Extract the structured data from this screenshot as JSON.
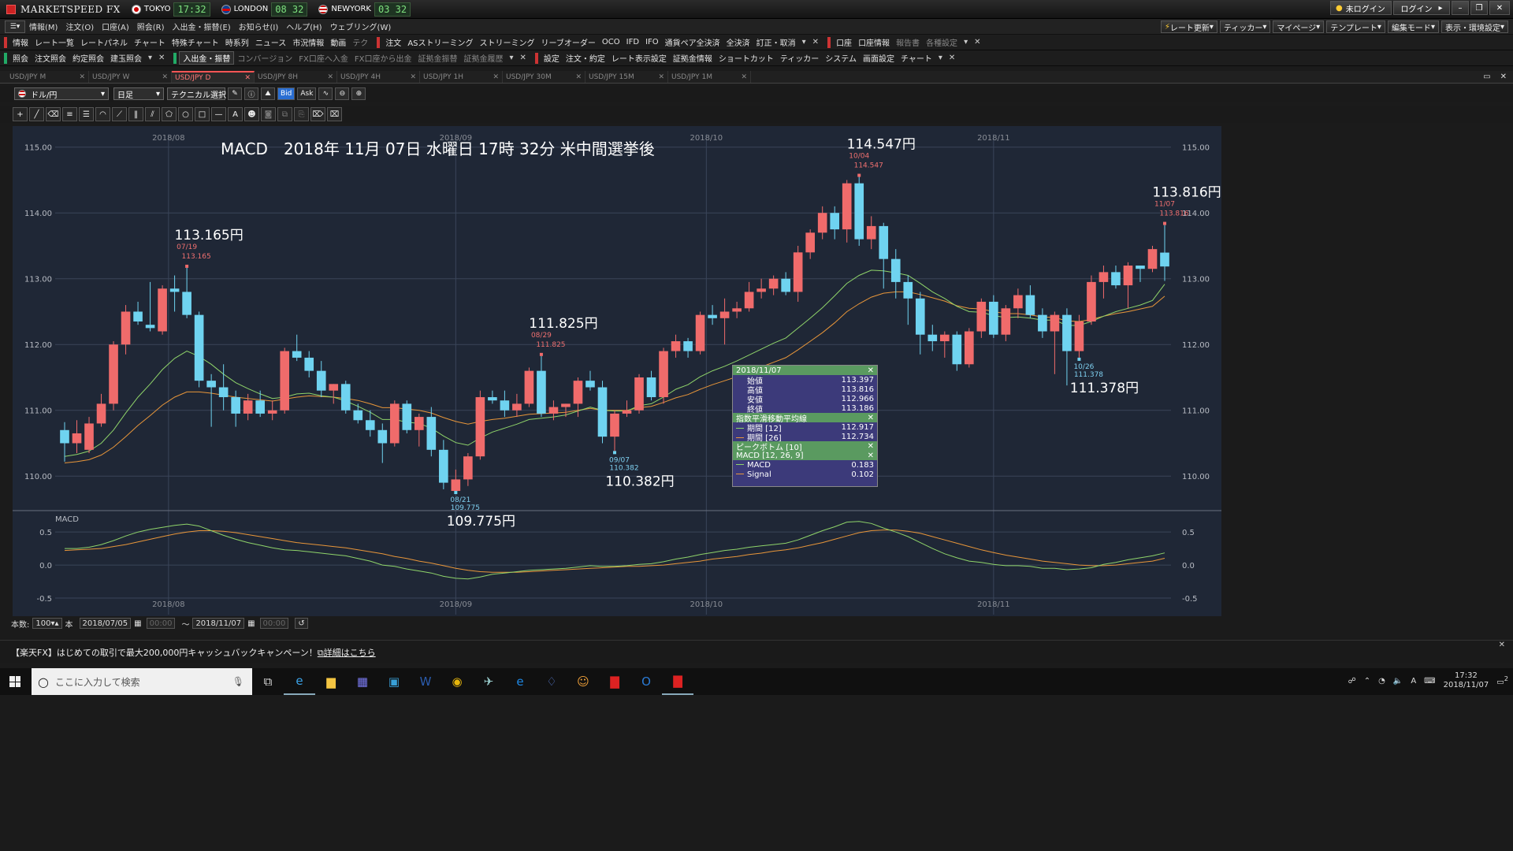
{
  "app": {
    "title": "MARKETSPEED FX"
  },
  "clocks": [
    {
      "city": "TOKYO",
      "time": "17:32"
    },
    {
      "city": "LONDON",
      "time": "08 32"
    },
    {
      "city": "NEWYORK",
      "time": "03 32"
    }
  ],
  "titlebar": {
    "login_status": "未ログイン",
    "login_button": "ログイン"
  },
  "menu": [
    "情報(M)",
    "注文(O)",
    "口座(A)",
    "照会(R)",
    "入出金・振替(E)",
    "お知らせ(I)",
    "ヘルプ(H)",
    "ウェブリング(W)"
  ],
  "menu_right": [
    "レート更新",
    "ティッカー",
    "マイページ",
    "テンプレート",
    "編集モード",
    "表示・環境設定"
  ],
  "toolbar1": {
    "info": "情報",
    "info_items": [
      "レート一覧",
      "レートパネル",
      "チャート",
      "特殊チャート",
      "時系列",
      "ニュース",
      "市況情報",
      "動画",
      "テク"
    ],
    "order": "注文",
    "order_items": [
      "ASストリーミング",
      "ストリーミング",
      "リーブオーダー",
      "OCO",
      "IFD",
      "IFO",
      "通貨ペア全決済",
      "全決済",
      "訂正・取消"
    ],
    "account": "口座",
    "account_items": [
      "口座情報",
      "報告書",
      "各種設定"
    ]
  },
  "toolbar2": {
    "inquiry": "照会",
    "inquiry_items": [
      "注文照会",
      "約定照会",
      "建玉照会"
    ],
    "funds": "入出金・振替",
    "funds_items": [
      "コンバージョン",
      "FX口座へ入金",
      "FX口座から出金",
      "証拠金振替",
      "証拠金履歴"
    ],
    "settings": "設定",
    "settings_items": [
      "注文・約定",
      "レート表示設定",
      "証拠金情報",
      "ショートカット",
      "ティッカー",
      "システム",
      "画面設定",
      "チャート"
    ]
  },
  "tabs": [
    "USD/JPY M",
    "USD/JPY W",
    "USD/JPY D",
    "USD/JPY 8H",
    "USD/JPY 4H",
    "USD/JPY 1H",
    "USD/JPY 30M",
    "USD/JPY 15M",
    "USD/JPY 1M"
  ],
  "active_tab": "USD/JPY D",
  "chart_controls": {
    "pair": "ドル/円",
    "period": "日足",
    "technical": "テクニカル選択",
    "bid": "Bid",
    "ask": "Ask"
  },
  "chart_data": {
    "type": "candlestick",
    "title": "MACD　2018年 11月 07日 水曜日 17時 32分 米中間選挙後",
    "x_labels": [
      {
        "label": "2018/08",
        "index": 8.5
      },
      {
        "label": "2018/09",
        "index": 32
      },
      {
        "label": "2018/10",
        "index": 52.5
      },
      {
        "label": "2018/11",
        "index": 76
      }
    ],
    "ylim": [
      109.5,
      115.2
    ],
    "yticks": [
      110.0,
      111.0,
      112.0,
      113.0,
      114.0,
      115.0
    ],
    "candles": [
      {
        "o": 110.7,
        "h": 110.82,
        "l": 110.22,
        "c": 110.5
      },
      {
        "o": 110.5,
        "h": 110.85,
        "l": 110.35,
        "c": 110.65
      },
      {
        "o": 110.4,
        "h": 110.9,
        "l": 110.35,
        "c": 110.8
      },
      {
        "o": 110.8,
        "h": 111.25,
        "l": 110.75,
        "c": 111.1
      },
      {
        "o": 111.1,
        "h": 112.05,
        "l": 111.0,
        "c": 112.0
      },
      {
        "o": 112.0,
        "h": 112.6,
        "l": 111.85,
        "c": 112.5
      },
      {
        "o": 112.5,
        "h": 112.65,
        "l": 112.3,
        "c": 112.35
      },
      {
        "o": 112.3,
        "h": 112.95,
        "l": 112.2,
        "c": 112.25
      },
      {
        "o": 112.2,
        "h": 112.9,
        "l": 112.15,
        "c": 112.85
      },
      {
        "o": 112.85,
        "h": 113.05,
        "l": 112.5,
        "c": 112.8
      },
      {
        "o": 112.8,
        "h": 113.165,
        "l": 112.4,
        "c": 112.45
      },
      {
        "o": 112.45,
        "h": 112.5,
        "l": 111.35,
        "c": 111.45
      },
      {
        "o": 111.45,
        "h": 111.55,
        "l": 110.75,
        "c": 111.35
      },
      {
        "o": 111.35,
        "h": 111.7,
        "l": 111.0,
        "c": 111.2
      },
      {
        "o": 111.2,
        "h": 111.3,
        "l": 110.75,
        "c": 110.95
      },
      {
        "o": 110.95,
        "h": 111.25,
        "l": 110.85,
        "c": 111.15
      },
      {
        "o": 111.15,
        "h": 111.3,
        "l": 110.9,
        "c": 110.95
      },
      {
        "o": 110.95,
        "h": 111.15,
        "l": 110.85,
        "c": 111.0
      },
      {
        "o": 111.0,
        "h": 111.95,
        "l": 110.95,
        "c": 111.9
      },
      {
        "o": 111.9,
        "h": 112.15,
        "l": 111.75,
        "c": 111.8
      },
      {
        "o": 111.8,
        "h": 111.9,
        "l": 111.5,
        "c": 111.6
      },
      {
        "o": 111.6,
        "h": 111.75,
        "l": 111.2,
        "c": 111.3
      },
      {
        "o": 111.3,
        "h": 111.4,
        "l": 111.1,
        "c": 111.4
      },
      {
        "o": 111.4,
        "h": 111.45,
        "l": 110.95,
        "c": 111.0
      },
      {
        "o": 111.0,
        "h": 111.1,
        "l": 110.8,
        "c": 110.85
      },
      {
        "o": 110.85,
        "h": 111.0,
        "l": 110.6,
        "c": 110.7
      },
      {
        "o": 110.7,
        "h": 110.8,
        "l": 110.2,
        "c": 110.5
      },
      {
        "o": 110.5,
        "h": 111.15,
        "l": 110.45,
        "c": 111.1
      },
      {
        "o": 111.1,
        "h": 111.15,
        "l": 110.65,
        "c": 110.7
      },
      {
        "o": 110.7,
        "h": 110.95,
        "l": 110.45,
        "c": 110.9
      },
      {
        "o": 110.9,
        "h": 111.05,
        "l": 110.3,
        "c": 110.4
      },
      {
        "o": 110.4,
        "h": 110.55,
        "l": 109.8,
        "c": 109.9
      },
      {
        "o": 109.775,
        "h": 110.1,
        "l": 109.775,
        "c": 109.95
      },
      {
        "o": 109.95,
        "h": 110.35,
        "l": 109.85,
        "c": 110.3
      },
      {
        "o": 110.3,
        "h": 111.3,
        "l": 110.25,
        "c": 111.2
      },
      {
        "o": 111.2,
        "h": 111.3,
        "l": 111.1,
        "c": 111.15
      },
      {
        "o": 111.15,
        "h": 111.3,
        "l": 110.9,
        "c": 111.0
      },
      {
        "o": 111.0,
        "h": 111.25,
        "l": 110.9,
        "c": 111.1
      },
      {
        "o": 111.1,
        "h": 111.65,
        "l": 111.05,
        "c": 111.6
      },
      {
        "o": 111.6,
        "h": 111.825,
        "l": 110.9,
        "c": 110.95
      },
      {
        "o": 110.95,
        "h": 111.15,
        "l": 110.85,
        "c": 111.05
      },
      {
        "o": 111.05,
        "h": 111.1,
        "l": 110.9,
        "c": 111.1
      },
      {
        "o": 111.1,
        "h": 111.5,
        "l": 110.9,
        "c": 111.45
      },
      {
        "o": 111.45,
        "h": 111.6,
        "l": 111.3,
        "c": 111.35
      },
      {
        "o": 111.35,
        "h": 111.45,
        "l": 110.5,
        "c": 110.6
      },
      {
        "o": 110.6,
        "h": 111.0,
        "l": 110.382,
        "c": 110.95
      },
      {
        "o": 110.95,
        "h": 111.15,
        "l": 110.9,
        "c": 111.0
      },
      {
        "o": 111.0,
        "h": 111.55,
        "l": 110.95,
        "c": 111.5
      },
      {
        "o": 111.5,
        "h": 111.6,
        "l": 111.15,
        "c": 111.2
      },
      {
        "o": 111.2,
        "h": 111.95,
        "l": 111.1,
        "c": 111.9
      },
      {
        "o": 111.9,
        "h": 112.15,
        "l": 111.8,
        "c": 112.05
      },
      {
        "o": 112.05,
        "h": 112.1,
        "l": 111.8,
        "c": 111.9
      },
      {
        "o": 111.9,
        "h": 112.5,
        "l": 111.85,
        "c": 112.45
      },
      {
        "o": 112.45,
        "h": 112.6,
        "l": 112.3,
        "c": 112.4
      },
      {
        "o": 112.4,
        "h": 112.7,
        "l": 112.0,
        "c": 112.5
      },
      {
        "o": 112.5,
        "h": 112.65,
        "l": 112.4,
        "c": 112.55
      },
      {
        "o": 112.55,
        "h": 112.95,
        "l": 112.5,
        "c": 112.8
      },
      {
        "o": 112.8,
        "h": 113.0,
        "l": 112.7,
        "c": 112.85
      },
      {
        "o": 112.85,
        "h": 113.05,
        "l": 112.75,
        "c": 113.0
      },
      {
        "o": 113.0,
        "h": 113.1,
        "l": 112.75,
        "c": 112.8
      },
      {
        "o": 112.8,
        "h": 113.5,
        "l": 112.65,
        "c": 113.4
      },
      {
        "o": 113.4,
        "h": 113.75,
        "l": 113.3,
        "c": 113.7
      },
      {
        "o": 113.7,
        "h": 114.1,
        "l": 113.6,
        "c": 114.0
      },
      {
        "o": 114.0,
        "h": 114.1,
        "l": 113.6,
        "c": 113.75
      },
      {
        "o": 113.75,
        "h": 114.5,
        "l": 113.55,
        "c": 114.45
      },
      {
        "o": 114.45,
        "h": 114.547,
        "l": 113.5,
        "c": 113.6
      },
      {
        "o": 113.6,
        "h": 113.95,
        "l": 113.45,
        "c": 113.8
      },
      {
        "o": 113.8,
        "h": 113.85,
        "l": 112.85,
        "c": 113.3
      },
      {
        "o": 113.3,
        "h": 113.45,
        "l": 112.7,
        "c": 112.95
      },
      {
        "o": 112.95,
        "h": 113.05,
        "l": 112.3,
        "c": 112.7
      },
      {
        "o": 112.7,
        "h": 112.8,
        "l": 111.85,
        "c": 112.15
      },
      {
        "o": 112.15,
        "h": 112.3,
        "l": 111.9,
        "c": 112.05
      },
      {
        "o": 112.05,
        "h": 112.2,
        "l": 111.8,
        "c": 112.15
      },
      {
        "o": 112.15,
        "h": 112.2,
        "l": 111.6,
        "c": 111.7
      },
      {
        "o": 111.7,
        "h": 112.25,
        "l": 111.65,
        "c": 112.2
      },
      {
        "o": 112.2,
        "h": 112.7,
        "l": 112.1,
        "c": 112.65
      },
      {
        "o": 112.65,
        "h": 112.75,
        "l": 112.1,
        "c": 112.15
      },
      {
        "o": 112.15,
        "h": 112.6,
        "l": 112.05,
        "c": 112.55
      },
      {
        "o": 112.55,
        "h": 112.85,
        "l": 112.4,
        "c": 112.75
      },
      {
        "o": 112.75,
        "h": 112.9,
        "l": 112.4,
        "c": 112.45
      },
      {
        "o": 112.45,
        "h": 112.55,
        "l": 112.1,
        "c": 112.2
      },
      {
        "o": 112.2,
        "h": 112.5,
        "l": 111.55,
        "c": 112.45
      },
      {
        "o": 112.45,
        "h": 112.55,
        "l": 111.378,
        "c": 111.9
      },
      {
        "o": 111.9,
        "h": 112.45,
        "l": 111.8,
        "c": 112.35
      },
      {
        "o": 112.35,
        "h": 113.05,
        "l": 112.3,
        "c": 112.95
      },
      {
        "o": 112.95,
        "h": 113.2,
        "l": 112.7,
        "c": 113.1
      },
      {
        "o": 113.1,
        "h": 113.2,
        "l": 112.85,
        "c": 112.9
      },
      {
        "o": 112.9,
        "h": 113.25,
        "l": 112.55,
        "c": 113.2
      },
      {
        "o": 113.2,
        "h": 113.2,
        "l": 112.95,
        "c": 113.15
      },
      {
        "o": 113.15,
        "h": 113.5,
        "l": 113.1,
        "c": 113.45
      },
      {
        "o": 113.397,
        "h": 113.816,
        "l": 112.966,
        "c": 113.186
      }
    ],
    "ema12": [
      110.3,
      110.33,
      110.38,
      110.5,
      110.7,
      110.96,
      111.2,
      111.4,
      111.62,
      111.79,
      111.9,
      111.82,
      111.7,
      111.55,
      111.42,
      111.33,
      111.25,
      111.18,
      111.2,
      111.25,
      111.26,
      111.22,
      111.2,
      111.14,
      111.06,
      110.97,
      110.86,
      110.86,
      110.82,
      110.8,
      110.73,
      110.61,
      110.51,
      110.47,
      110.58,
      110.67,
      110.73,
      110.79,
      110.86,
      110.88,
      110.9,
      110.93,
      110.99,
      111.05,
      111.0,
      110.99,
      110.99,
      111.07,
      111.1,
      111.2,
      111.32,
      111.39,
      111.51,
      111.6,
      111.67,
      111.75,
      111.84,
      111.93,
      112.02,
      112.1,
      112.25,
      112.4,
      112.56,
      112.74,
      112.93,
      113.05,
      113.13,
      113.12,
      113.09,
      113.05,
      112.93,
      112.8,
      112.7,
      112.58,
      112.5,
      112.49,
      112.44,
      112.41,
      112.42,
      112.4,
      112.37,
      112.37,
      112.29,
      112.29,
      112.35,
      112.43,
      112.5,
      112.55,
      112.6,
      112.67,
      112.917
    ],
    "ema26": [
      110.2,
      110.22,
      110.25,
      110.32,
      110.44,
      110.6,
      110.77,
      110.92,
      111.08,
      111.2,
      111.28,
      111.28,
      111.26,
      111.23,
      111.2,
      111.18,
      111.16,
      111.14,
      111.17,
      111.2,
      111.22,
      111.21,
      111.2,
      111.18,
      111.15,
      111.1,
      111.04,
      111.04,
      111.02,
      111.0,
      110.96,
      110.89,
      110.83,
      110.79,
      110.83,
      110.86,
      110.88,
      110.91,
      110.94,
      110.95,
      110.96,
      110.97,
      111.0,
      111.03,
      111.0,
      111.0,
      111.0,
      111.04,
      111.06,
      111.12,
      111.19,
      111.24,
      111.32,
      111.39,
      111.45,
      111.51,
      111.58,
      111.66,
      111.73,
      111.8,
      111.92,
      112.05,
      112.18,
      112.33,
      112.5,
      112.62,
      112.72,
      112.78,
      112.8,
      112.8,
      112.76,
      112.71,
      112.66,
      112.59,
      112.55,
      112.54,
      112.5,
      112.47,
      112.47,
      112.45,
      112.42,
      112.41,
      112.36,
      112.35,
      112.38,
      112.43,
      112.47,
      112.5,
      112.54,
      112.58,
      112.734
    ],
    "macd": [
      0.25,
      0.25,
      0.27,
      0.31,
      0.37,
      0.44,
      0.5,
      0.54,
      0.57,
      0.6,
      0.62,
      0.59,
      0.52,
      0.45,
      0.39,
      0.34,
      0.3,
      0.26,
      0.23,
      0.22,
      0.2,
      0.18,
      0.16,
      0.14,
      0.1,
      0.06,
      0.0,
      -0.02,
      -0.06,
      -0.09,
      -0.12,
      -0.17,
      -0.2,
      -0.21,
      -0.18,
      -0.14,
      -0.12,
      -0.1,
      -0.08,
      -0.07,
      -0.06,
      -0.05,
      -0.03,
      -0.01,
      -0.02,
      -0.02,
      -0.01,
      0.01,
      0.02,
      0.05,
      0.09,
      0.12,
      0.16,
      0.19,
      0.22,
      0.24,
      0.27,
      0.29,
      0.31,
      0.33,
      0.38,
      0.45,
      0.52,
      0.58,
      0.65,
      0.66,
      0.63,
      0.56,
      0.5,
      0.43,
      0.34,
      0.25,
      0.17,
      0.11,
      0.06,
      0.04,
      0.01,
      -0.01,
      -0.01,
      -0.02,
      -0.05,
      -0.05,
      -0.07,
      -0.06,
      -0.04,
      0.01,
      0.04,
      0.08,
      0.11,
      0.14,
      0.183
    ],
    "signal": [
      0.22,
      0.23,
      0.24,
      0.25,
      0.28,
      0.31,
      0.35,
      0.39,
      0.43,
      0.47,
      0.5,
      0.52,
      0.52,
      0.51,
      0.49,
      0.46,
      0.43,
      0.4,
      0.37,
      0.34,
      0.32,
      0.3,
      0.28,
      0.26,
      0.23,
      0.2,
      0.17,
      0.13,
      0.1,
      0.06,
      0.03,
      -0.01,
      -0.05,
      -0.08,
      -0.1,
      -0.11,
      -0.11,
      -0.11,
      -0.1,
      -0.09,
      -0.08,
      -0.07,
      -0.06,
      -0.05,
      -0.04,
      -0.03,
      -0.02,
      -0.02,
      -0.01,
      0.0,
      0.02,
      0.04,
      0.06,
      0.09,
      0.11,
      0.13,
      0.16,
      0.18,
      0.21,
      0.23,
      0.26,
      0.3,
      0.34,
      0.39,
      0.44,
      0.49,
      0.52,
      0.53,
      0.53,
      0.51,
      0.48,
      0.43,
      0.38,
      0.33,
      0.28,
      0.23,
      0.19,
      0.15,
      0.12,
      0.09,
      0.06,
      0.04,
      0.02,
      0.0,
      -0.01,
      -0.01,
      0.0,
      0.02,
      0.04,
      0.06,
      0.102
    ],
    "macd_ylim": [
      -0.75,
      0.8
    ],
    "macd_yticks": [
      0.5,
      0.0,
      -0.5
    ],
    "colors": {
      "bull": "#f06b6b",
      "bear": "#6fd3f0",
      "ema12": "#8fd46a",
      "ema26": "#e8963a",
      "macd": "#8fd46a",
      "signal": "#e8963a",
      "bg": "#1f2736"
    },
    "markers": [
      {
        "index": 10,
        "type": "high",
        "date": "07/19",
        "value": "113.165",
        "label": "113.165円"
      },
      {
        "index": 32,
        "type": "low",
        "date": "08/21",
        "value": "109.775",
        "label": "109.775円"
      },
      {
        "index": 39,
        "type": "high",
        "date": "08/29",
        "value": "111.825",
        "label": "111.825円"
      },
      {
        "index": 45,
        "type": "low",
        "date": "09/07",
        "value": "110.382",
        "label": "110.382円"
      },
      {
        "index": 65,
        "type": "high",
        "date": "10/04",
        "value": "114.547",
        "label": "114.547円"
      },
      {
        "index": 83,
        "type": "low",
        "date": "10/26",
        "value": "111.378",
        "label": "111.378円"
      },
      {
        "index": 90,
        "type": "high",
        "date": "11/07",
        "value": "113.816",
        "label": "113.816円"
      }
    ],
    "macd_label": "MACD"
  },
  "infobox": {
    "date": "2018/11/07",
    "ohlc": [
      {
        "k": "始値",
        "v": "113.397"
      },
      {
        "k": "高値",
        "v": "113.816"
      },
      {
        "k": "安値",
        "v": "112.966"
      },
      {
        "k": "終値",
        "v": "113.186"
      }
    ],
    "ema_title": "指数平滑移動平均線",
    "ema": [
      {
        "k": "期間 [12]",
        "v": "112.917",
        "color": "#8fd46a"
      },
      {
        "k": "期間 [26]",
        "v": "112.734",
        "color": "#e8963a"
      }
    ],
    "peak_title": "ピークボトム [10]",
    "macd_title": "MACD [12, 26, 9]",
    "macd": [
      {
        "k": "MACD",
        "v": "0.183",
        "color": "#8fd46a"
      },
      {
        "k": "Signal",
        "v": "0.102",
        "color": "#e8963a"
      }
    ]
  },
  "bottom": {
    "count_label": "本数:",
    "count": "100",
    "unit": "本",
    "from": "2018/07/05",
    "from_time": "00:00",
    "sep": "～",
    "to": "2018/11/07",
    "to_time": "00:00"
  },
  "promo": {
    "text": "【楽天FX】はじめての取引で最大200,000円キャッシュバックキャンペーン！",
    "link": "詳細はこちら"
  },
  "taskbar": {
    "search": "ここに入力して検索",
    "time": "17:32",
    "date": "2018/11/07",
    "ime": "A",
    "notif": "2"
  }
}
